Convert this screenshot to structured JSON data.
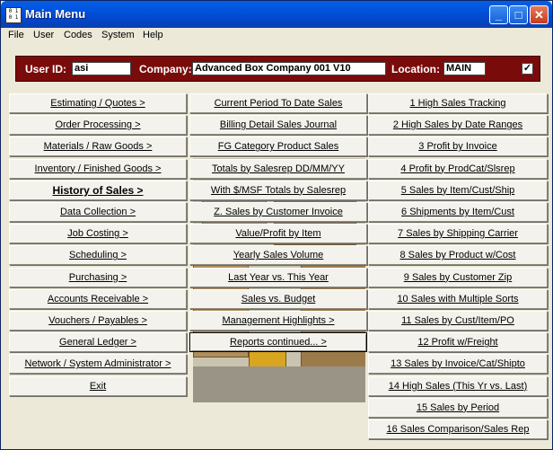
{
  "window": {
    "title": "Main Menu",
    "icon_text": "0 1 0 1"
  },
  "titlebar_buttons": {
    "minimize": "_",
    "maximize": "□",
    "close": "✕"
  },
  "menubar": [
    "File",
    "User",
    "Codes",
    "System",
    "Help"
  ],
  "info": {
    "user_id_label": "User ID:",
    "user_id": "asi",
    "company_label": "Company:",
    "company": "Advanced Box Company 001 V10",
    "location_label": "Location:",
    "location": "MAIN",
    "checked": "✓"
  },
  "left_menu": [
    "Estimating / Quotes >",
    "Order Processing >",
    "Materials / Raw Goods >",
    "Inventory / Finished Goods >",
    "History of Sales >",
    "Data Collection >",
    "Job Costing >",
    "Scheduling >",
    "Purchasing >",
    "Accounts Receivable >",
    "Vouchers / Payables >",
    "General Ledger >",
    "Network / System Administrator >",
    "Exit"
  ],
  "middle_menu": [
    "Current Period To Date Sales",
    "Billing Detail Sales Journal",
    "FG Category Product Sales",
    "Totals by Salesrep  DD/MM/YY",
    "With $/MSF Totals by Salesrep",
    "Z. Sales by Customer Invoice",
    "Value/Profit by Item",
    "Yearly Sales Volume",
    "Last Year vs. This Year",
    "Sales vs. Budget",
    "Management Highlights >",
    "Reports continued... >"
  ],
  "right_menu": [
    "1 High Sales Tracking",
    "2 High Sales by Date Ranges",
    "3 Profit by Invoice",
    "4 Profit by ProdCat/Slsrep",
    "5 Sales by Item/Cust/Ship",
    "6 Shipments by Item/Cust",
    "7 Sales by Shipping Carrier",
    "8 Sales by Product w/Cost",
    "9 Sales by Customer Zip",
    "10 Sales with Multiple Sorts",
    "11 Sales by Cust/Item/PO",
    "12 Profit w/Freight",
    "13 Sales by Invoice/Cat/Shipto",
    "14 High Sales (This Yr vs. Last)",
    "15 Sales by Period",
    "16 Sales Comparison/Sales Rep"
  ]
}
